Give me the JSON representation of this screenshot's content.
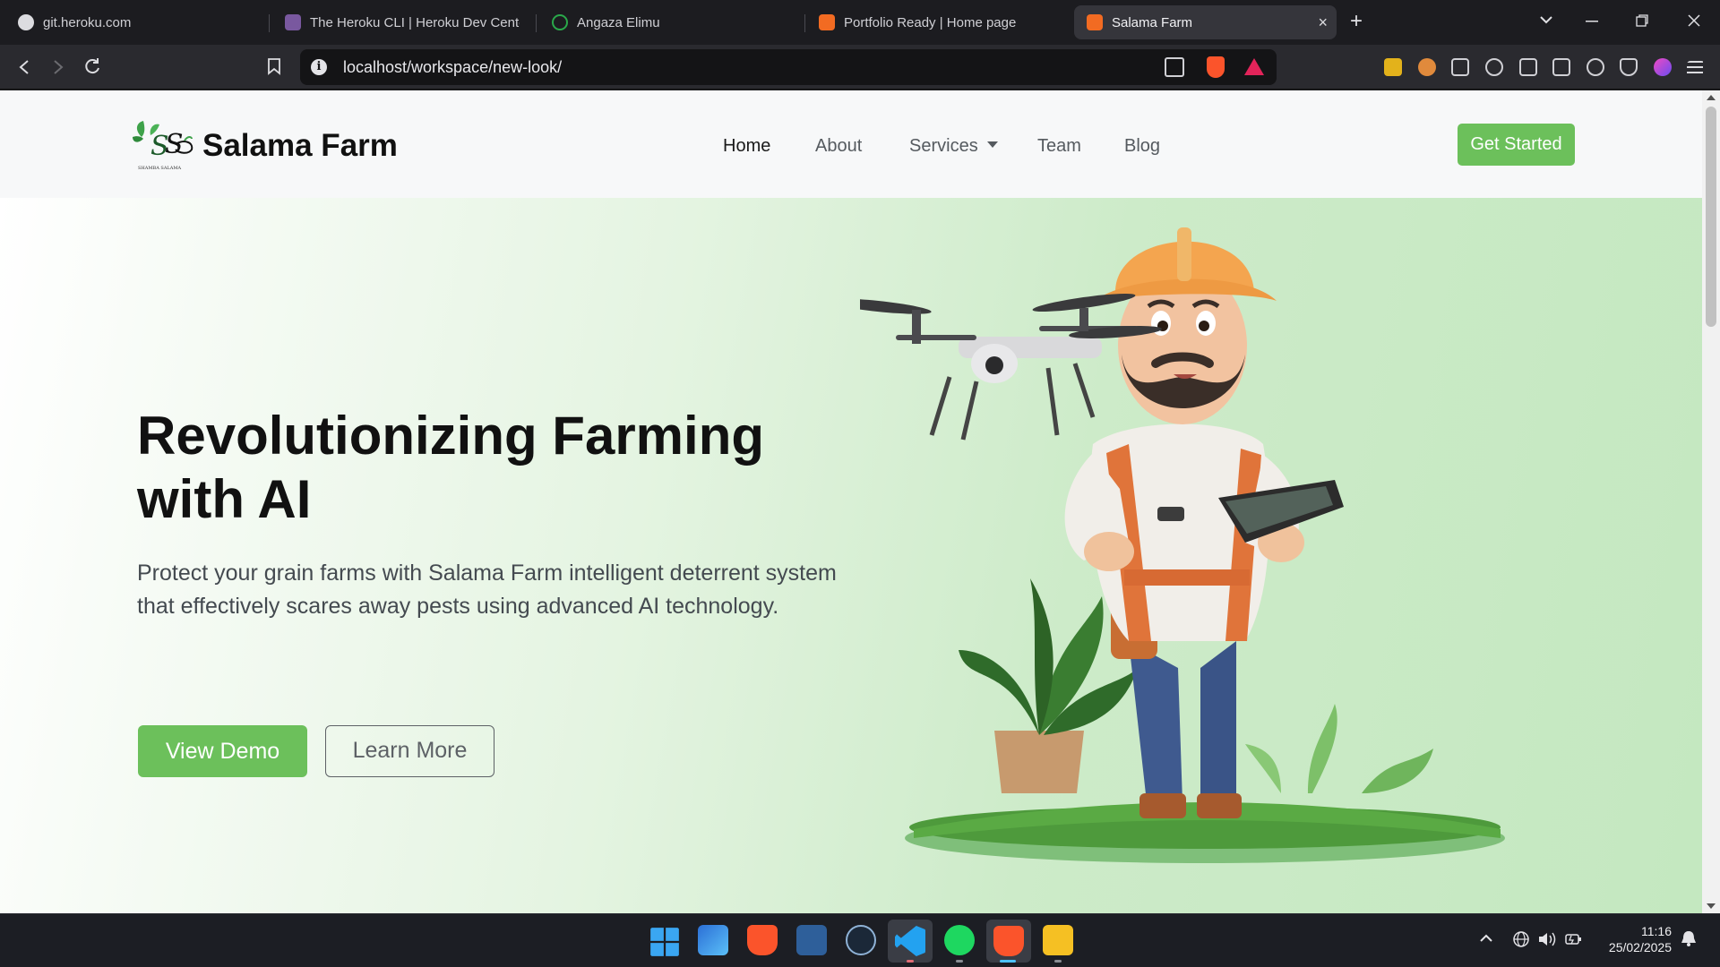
{
  "browser": {
    "tabs": [
      {
        "title": "git.heroku.com",
        "active": false
      },
      {
        "title": "The Heroku CLI | Heroku Dev Center",
        "active": false
      },
      {
        "title": "Angaza Elimu",
        "active": false
      },
      {
        "title": "Portfolio Ready | Home page",
        "active": false
      },
      {
        "title": "Salama Farm",
        "active": true
      }
    ],
    "new_tab_label": "+",
    "close_tab_label": "×",
    "url": "localhost/workspace/new-look/"
  },
  "site": {
    "brand": "Salama Farm",
    "logo_caption": "SHAMBA SALAMA",
    "nav": {
      "home": "Home",
      "about": "About",
      "services": "Services",
      "team": "Team",
      "blog": "Blog"
    },
    "cta": "Get Started",
    "hero": {
      "title": "Revolutionizing Farming with AI",
      "subtitle": "Protect your grain farms with Salama Farm intelligent deterrent system that effectively scares away pests using advanced AI technology.",
      "primary_button": "View Demo",
      "secondary_button": "Learn More"
    },
    "colors": {
      "accent": "#6cc05b"
    }
  },
  "taskbar": {
    "time": "11:16",
    "date": "25/02/2025"
  }
}
